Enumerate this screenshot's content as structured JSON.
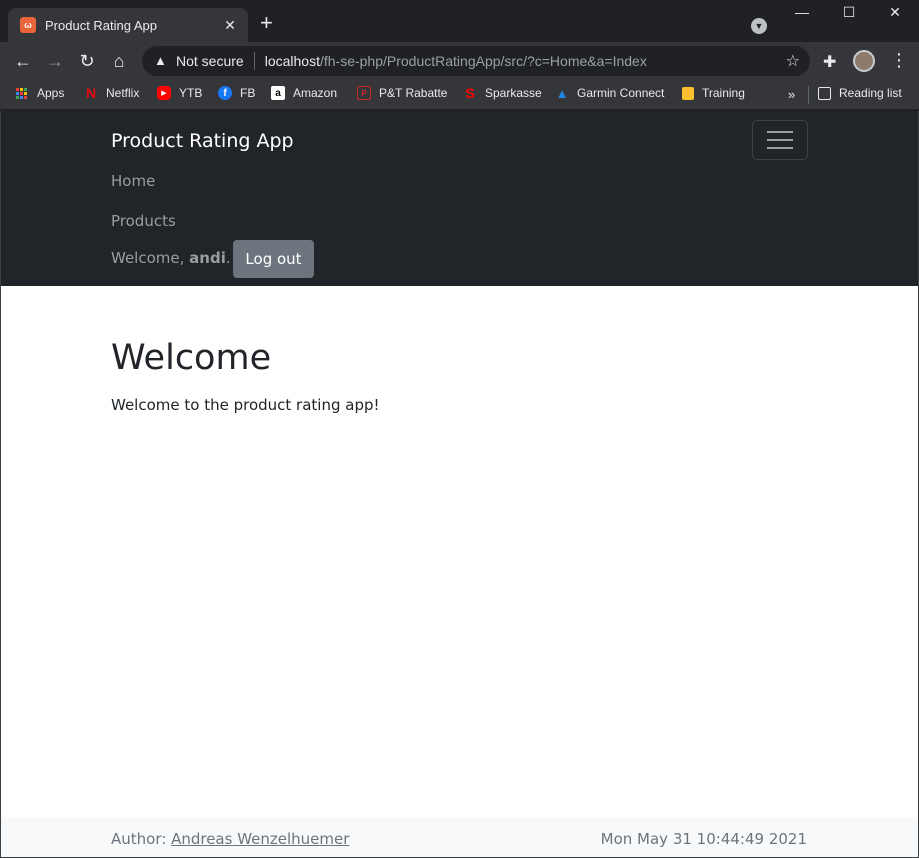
{
  "browser": {
    "tab": {
      "title": "Product Rating App",
      "favicon": "xampp-icon"
    },
    "window_controls": [
      "minimize-icon",
      "maximize-icon",
      "close-icon"
    ],
    "omnibox": {
      "security_label": "Not secure",
      "url_host": "localhost",
      "url_path": "/fh-se-php/ProductRatingApp/src/?c=Home&a=Index"
    },
    "bookmarks": [
      {
        "label": "Apps",
        "icon": "apps-grid-icon"
      },
      {
        "label": "Netflix",
        "icon": "netflix-icon",
        "color": "#e50914"
      },
      {
        "label": "YTB",
        "icon": "youtube-icon",
        "color": "#ff0000"
      },
      {
        "label": "FB",
        "icon": "facebook-icon",
        "color": "#1877f2"
      },
      {
        "label": "Amazon",
        "icon": "amazon-icon",
        "color": "#ffffff"
      },
      {
        "label": "P&T Rabatte",
        "icon": "pt-rabatte-icon",
        "color": "#c62828"
      },
      {
        "label": "Sparkasse",
        "icon": "sparkasse-icon",
        "color": "#ff0000"
      },
      {
        "label": "Garmin Connect",
        "icon": "garmin-icon",
        "color": "#1e88e5"
      },
      {
        "label": "Training",
        "icon": "folder-icon",
        "color": "#fbc02d"
      }
    ],
    "overflow": "»",
    "reading_list": "Reading list"
  },
  "site": {
    "brand": "Product Rating App",
    "nav": {
      "home": "Home",
      "products": "Products"
    },
    "user": {
      "welcome_prefix": "Welcome, ",
      "username": "andi",
      "welcome_suffix": ".",
      "logout_label": "Log out"
    },
    "main": {
      "heading": "Welcome",
      "text": "Welcome to the product rating app!"
    },
    "footer": {
      "author_prefix": "Author: ",
      "author_name": "Andreas Wenzelhuemer",
      "datetime": "Mon May 31 10:44:49 2021"
    }
  },
  "colors": {
    "navbar_bg": "#212529",
    "button_secondary": "#6c757d",
    "footer_bg": "#f8f9fa",
    "chrome_dark": "#202124",
    "chrome_toolbar": "#35363a"
  }
}
